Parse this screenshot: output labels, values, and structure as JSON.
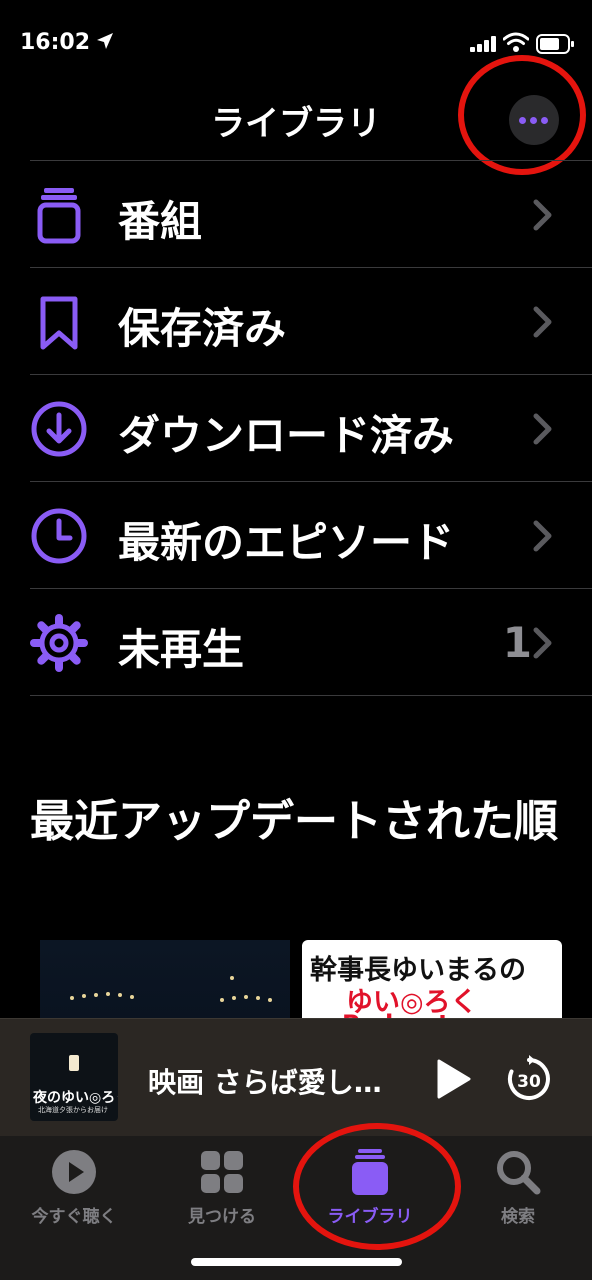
{
  "status_bar": {
    "time": "16:02"
  },
  "nav": {
    "title": "ライブラリ",
    "more_icon": "ellipsis-icon"
  },
  "accent_color": "#8a5cf5",
  "annotation_color": "#e4140e",
  "menu": [
    {
      "label": "番組",
      "icon": "shows-stack-icon"
    },
    {
      "label": "保存済み",
      "icon": "bookmark-icon"
    },
    {
      "label": "ダウンロード済み",
      "icon": "download-circle-icon"
    },
    {
      "label": "最新のエピソード",
      "icon": "clock-icon"
    },
    {
      "label": "未再生",
      "icon": "gear-icon",
      "count": "1"
    }
  ],
  "section": {
    "title": "最近アップデートされた順"
  },
  "thumbnails": [
    {
      "name": "night-podcast-art"
    },
    {
      "line1": "幹事長ゆいまるの",
      "line2": "ゆい◎ろく",
      "line3": "Podcasts"
    }
  ],
  "now_playing": {
    "title": "映画 さらば愛し…",
    "art_title": "夜のゆい◎ろく",
    "art_subtitle": "北海道夕張からお届け",
    "skip_seconds": "30"
  },
  "tabs": [
    {
      "label": "今すぐ聴く",
      "icon": "play-circle-icon"
    },
    {
      "label": "見つける",
      "icon": "grid-icon"
    },
    {
      "label": "ライブラリ",
      "icon": "library-stack-icon",
      "active": true
    },
    {
      "label": "検索",
      "icon": "search-icon"
    }
  ]
}
